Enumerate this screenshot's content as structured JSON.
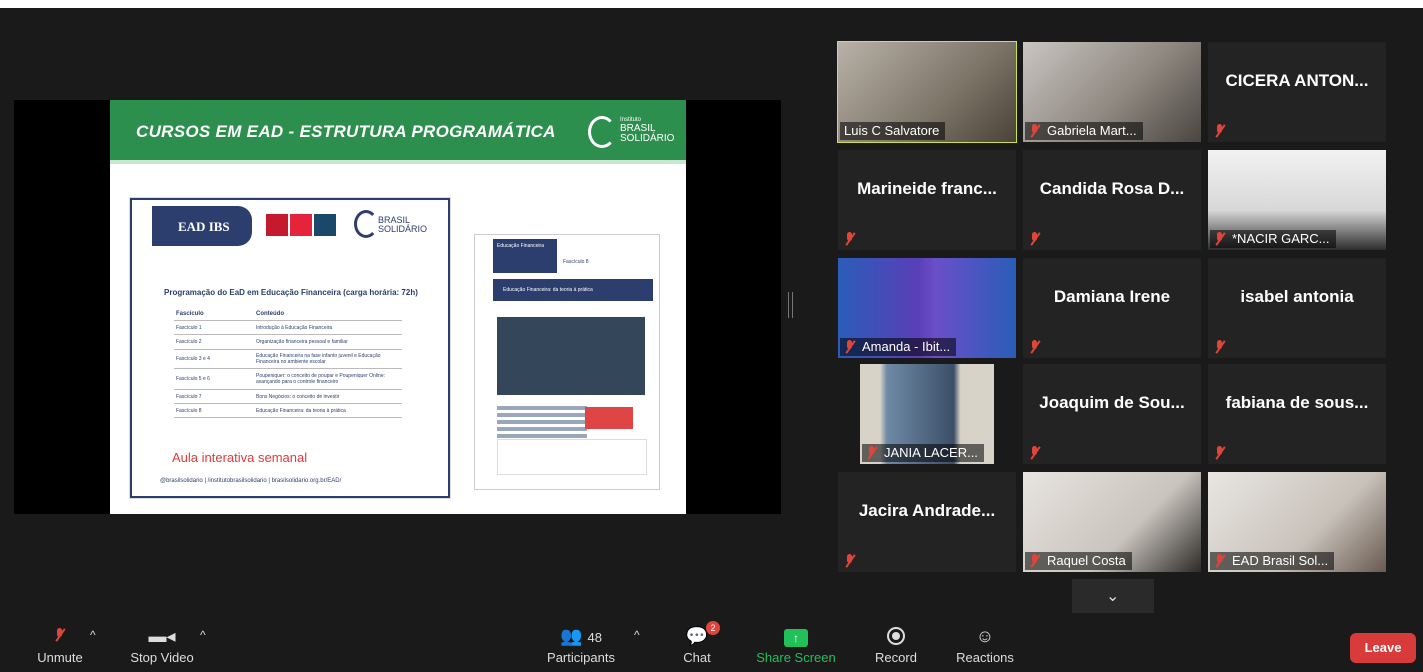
{
  "slide": {
    "title": "CURSOS EM EAD - ESTRUTURA PROGRAMÁTICA",
    "brand_small": "Instituto",
    "brand_big": "BRASIL SOLIDÁRIO",
    "card_tab": "EAD IBS",
    "card_logo": "BRASIL SOLIDÁRIO",
    "program_title": "Programação do EaD em Educação Financeira (carga horária: 72h)",
    "table_headers": [
      "Fascículo",
      "Conteúdo"
    ],
    "table_rows": [
      [
        "Fascículo 1",
        "Introdução à Educação Financeira"
      ],
      [
        "Fascículo 2",
        "Organização financeira pessoal e familiar"
      ],
      [
        "Fascículo 3 e 4",
        "Educação Financeira na fase infanto juvenil e Educação Financeira no ambiente escolar"
      ],
      [
        "Fascículo 5 e 6",
        "Poupeniquer: o conceito de poupar e Poupeniquer Online: avançando para o controle financeiro"
      ],
      [
        "Fascículo 7",
        "Bons Negócios: o conceito de investir"
      ],
      [
        "Fascículo 8",
        "Educação Financeira: da teoria à prática"
      ]
    ],
    "aula": "Aula interativa semanal",
    "social": "@brasilsolidario | /institutobrasilsolidario | brasilsolidario.org.br/EAD/",
    "flyer_band": "Educação Financeira: da teoria à prática",
    "flyer_header": "Educação Financeira",
    "flyer_fasciculo": "Fascículo 8"
  },
  "participants": [
    {
      "name": "Luis C Salvatore",
      "video": true,
      "active": true,
      "muted": false
    },
    {
      "name": "Gabriela Mart...",
      "video": true,
      "muted": true
    },
    {
      "name": "CICERA ANTON...",
      "video": false,
      "muted": true
    },
    {
      "name": "Marineide franc...",
      "video": false,
      "muted": true
    },
    {
      "name": "Candida Rosa D...",
      "video": false,
      "muted": true
    },
    {
      "name": "*NACIR GARC...",
      "video": true,
      "muted": true
    },
    {
      "name": "Amanda - Ibit...",
      "video": true,
      "muted": true
    },
    {
      "name": "Damiana Irene",
      "video": false,
      "muted": true
    },
    {
      "name": "isabel antonia",
      "video": false,
      "muted": true
    },
    {
      "name": "JANIA LACER...",
      "video": true,
      "muted": true
    },
    {
      "name": "Joaquim de Sou...",
      "video": false,
      "muted": true
    },
    {
      "name": "fabiana de sous...",
      "video": false,
      "muted": true
    },
    {
      "name": "Jacira Andrade...",
      "video": false,
      "muted": true
    },
    {
      "name": "Raquel Costa",
      "video": true,
      "muted": true
    },
    {
      "name": "EAD Brasil Sol...",
      "video": true,
      "muted": true
    }
  ],
  "toolbar": {
    "unmute": "Unmute",
    "stop_video": "Stop Video",
    "participants": "Participants",
    "participants_count": "48",
    "chat": "Chat",
    "chat_badge": "2",
    "share_screen": "Share Screen",
    "record": "Record",
    "reactions": "Reactions",
    "leave": "Leave"
  },
  "colors": {
    "slide_green": "#2c8f4d",
    "slide_navy": "#2c3e6e",
    "aula_red": "#e23b3b",
    "active_border": "#cde04a",
    "leave_red": "#d93a3a",
    "share_green": "#21c05a",
    "mute_red": "#e0453a"
  },
  "icons": {
    "unmute": "mic-off-icon",
    "video": "video-camera-icon",
    "participants": "people-icon",
    "chat": "chat-bubble-icon",
    "share": "share-arrow-icon",
    "record": "record-icon",
    "reactions": "smiley-plus-icon",
    "expand": "chevron-down-icon"
  }
}
